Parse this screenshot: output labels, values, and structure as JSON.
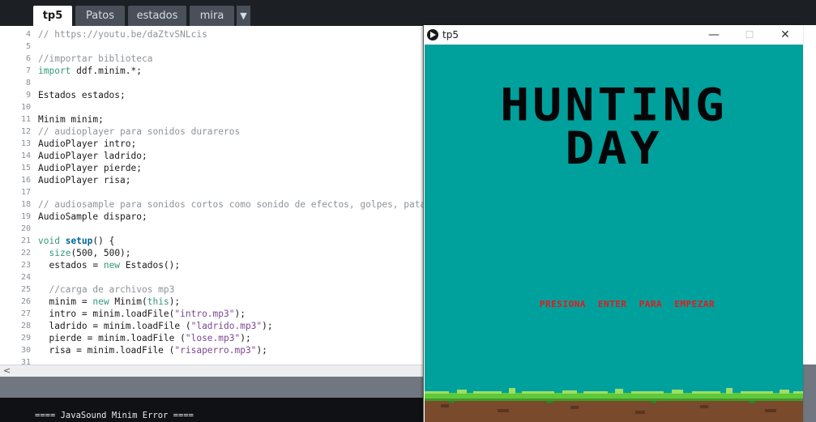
{
  "tabs": [
    {
      "label": "tp5",
      "active": true
    },
    {
      "label": "Patos",
      "active": false
    },
    {
      "label": "estados",
      "active": false
    },
    {
      "label": "mira",
      "active": false
    }
  ],
  "tab_menu_icon": "chevron-down-icon",
  "code_lines": [
    {
      "n": "4",
      "parts": [
        {
          "t": "// https://youtu.be/daZtvSNLcis",
          "c": "com"
        }
      ]
    },
    {
      "n": "5",
      "parts": []
    },
    {
      "n": "6",
      "parts": [
        {
          "t": "//importar biblioteca",
          "c": "com"
        }
      ]
    },
    {
      "n": "7",
      "parts": [
        {
          "t": "import",
          "c": "key"
        },
        {
          "t": " ddf.minim.*;",
          "c": ""
        }
      ]
    },
    {
      "n": "8",
      "parts": []
    },
    {
      "n": "9",
      "parts": [
        {
          "t": "Estados estados;",
          "c": ""
        }
      ]
    },
    {
      "n": "10",
      "parts": []
    },
    {
      "n": "11",
      "parts": [
        {
          "t": "Minim minim;",
          "c": ""
        }
      ]
    },
    {
      "n": "12",
      "parts": [
        {
          "t": "// audioplayer para sonidos durareros",
          "c": "com"
        }
      ]
    },
    {
      "n": "13",
      "parts": [
        {
          "t": "AudioPlayer intro;",
          "c": ""
        }
      ]
    },
    {
      "n": "14",
      "parts": [
        {
          "t": "AudioPlayer ladrido;",
          "c": ""
        }
      ]
    },
    {
      "n": "15",
      "parts": [
        {
          "t": "AudioPlayer pierde;",
          "c": ""
        }
      ]
    },
    {
      "n": "16",
      "parts": [
        {
          "t": "AudioPlayer risa;",
          "c": ""
        }
      ]
    },
    {
      "n": "17",
      "parts": []
    },
    {
      "n": "18",
      "parts": [
        {
          "t": "// audiosample para sonidos cortos como sonido de efectos, golpes, patada",
          "c": "com"
        }
      ]
    },
    {
      "n": "19",
      "parts": [
        {
          "t": "AudioSample disparo;",
          "c": ""
        }
      ]
    },
    {
      "n": "20",
      "parts": []
    },
    {
      "n": "21",
      "parts": [
        {
          "t": "void",
          "c": "key"
        },
        {
          "t": " ",
          "c": ""
        },
        {
          "t": "setup",
          "c": "fn"
        },
        {
          "t": "() {",
          "c": ""
        }
      ]
    },
    {
      "n": "22",
      "parts": [
        {
          "t": "  ",
          "c": ""
        },
        {
          "t": "size",
          "c": "key"
        },
        {
          "t": "(500, 500);",
          "c": ""
        }
      ]
    },
    {
      "n": "23",
      "parts": [
        {
          "t": "  estados = ",
          "c": ""
        },
        {
          "t": "new",
          "c": "key"
        },
        {
          "t": " Estados();",
          "c": ""
        }
      ]
    },
    {
      "n": "24",
      "parts": []
    },
    {
      "n": "25",
      "parts": [
        {
          "t": "  //carga de archivos mp3",
          "c": "com"
        }
      ]
    },
    {
      "n": "26",
      "parts": [
        {
          "t": "  minim = ",
          "c": ""
        },
        {
          "t": "new",
          "c": "key"
        },
        {
          "t": " Minim(",
          "c": ""
        },
        {
          "t": "this",
          "c": "key"
        },
        {
          "t": ");",
          "c": ""
        }
      ]
    },
    {
      "n": "27",
      "parts": [
        {
          "t": "  intro = minim.loadFile(",
          "c": ""
        },
        {
          "t": "\"intro.mp3\"",
          "c": "str"
        },
        {
          "t": ");",
          "c": ""
        }
      ]
    },
    {
      "n": "28",
      "parts": [
        {
          "t": "  ladrido = minim.loadFile (",
          "c": ""
        },
        {
          "t": "\"ladrido.mp3\"",
          "c": "str"
        },
        {
          "t": ");",
          "c": ""
        }
      ]
    },
    {
      "n": "29",
      "parts": [
        {
          "t": "  pierde = minim.loadFile (",
          "c": ""
        },
        {
          "t": "\"lose.mp3\"",
          "c": "str"
        },
        {
          "t": ");",
          "c": ""
        }
      ]
    },
    {
      "n": "30",
      "parts": [
        {
          "t": "  risa = minim.loadFile (",
          "c": ""
        },
        {
          "t": "\"risaperro.mp3\"",
          "c": "str"
        },
        {
          "t": ");",
          "c": ""
        }
      ]
    },
    {
      "n": "31",
      "parts": []
    }
  ],
  "scroll_left_arrow": "<",
  "console_text": "==== JavaSound Minim Error ====",
  "sketch_window": {
    "title": "tp5",
    "minimize": "—",
    "maximize": "☐",
    "close": "✕",
    "game_title_line1": "HUNTING",
    "game_title_line2": "DAY",
    "prompt": "PRESIONA ENTER PARA EMPEZAR"
  },
  "colors": {
    "sky": "#00a09c",
    "grass": "#5fc93a",
    "dirt": "#7a4a2c",
    "prompt": "#e31b1b"
  }
}
